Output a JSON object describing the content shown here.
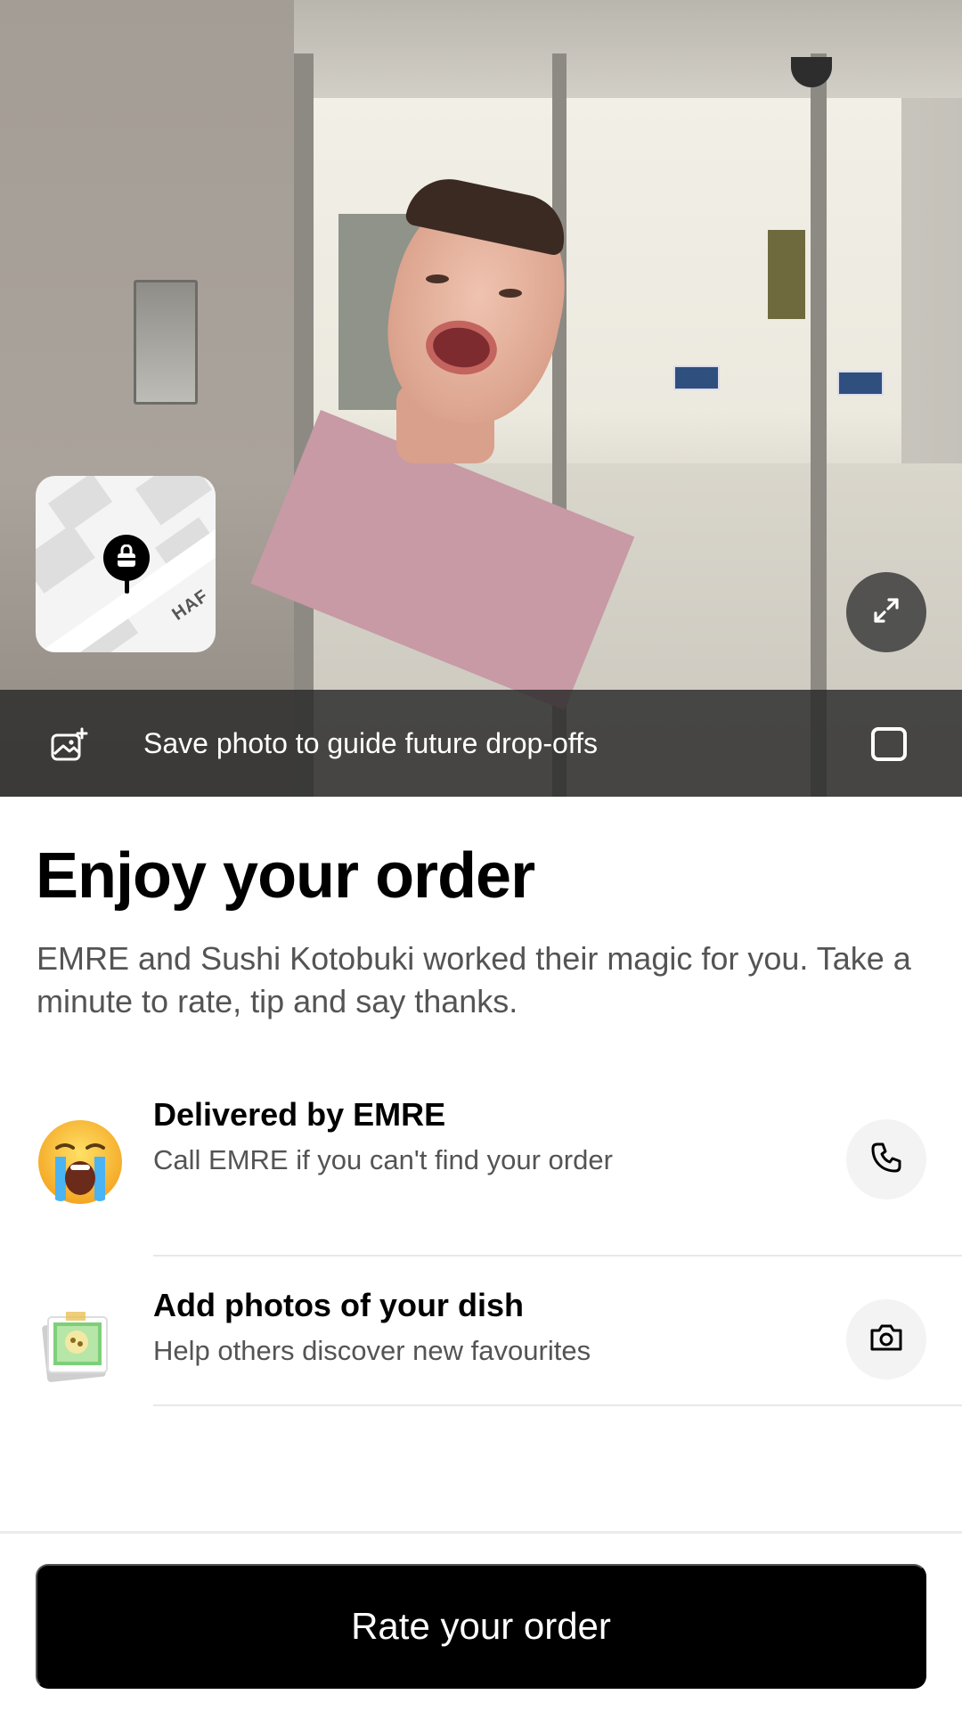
{
  "photo_banner": {
    "save_label": "Save photo to guide future drop-offs",
    "save_checked": false,
    "map_street_label": "HAF"
  },
  "order": {
    "title": "Enjoy your order",
    "subtitle": "EMRE and Sushi Kotobuki worked their magic for you. Take a minute to rate, tip and say thanks."
  },
  "rows": [
    {
      "title": "Delivered by EMRE",
      "subtitle": "Call EMRE if you can't find your order",
      "leading_icon": "crying-face-emoji",
      "action_icon": "phone-icon"
    },
    {
      "title": "Add photos of your dish",
      "subtitle": "Help others discover new favourites",
      "leading_icon": "photo-of-dish-illustration",
      "action_icon": "camera-icon"
    }
  ],
  "cta": {
    "label": "Rate your order"
  },
  "colors": {
    "primary": "#000000",
    "secondary_text": "#545454",
    "action_bg": "#f3f3f3"
  }
}
